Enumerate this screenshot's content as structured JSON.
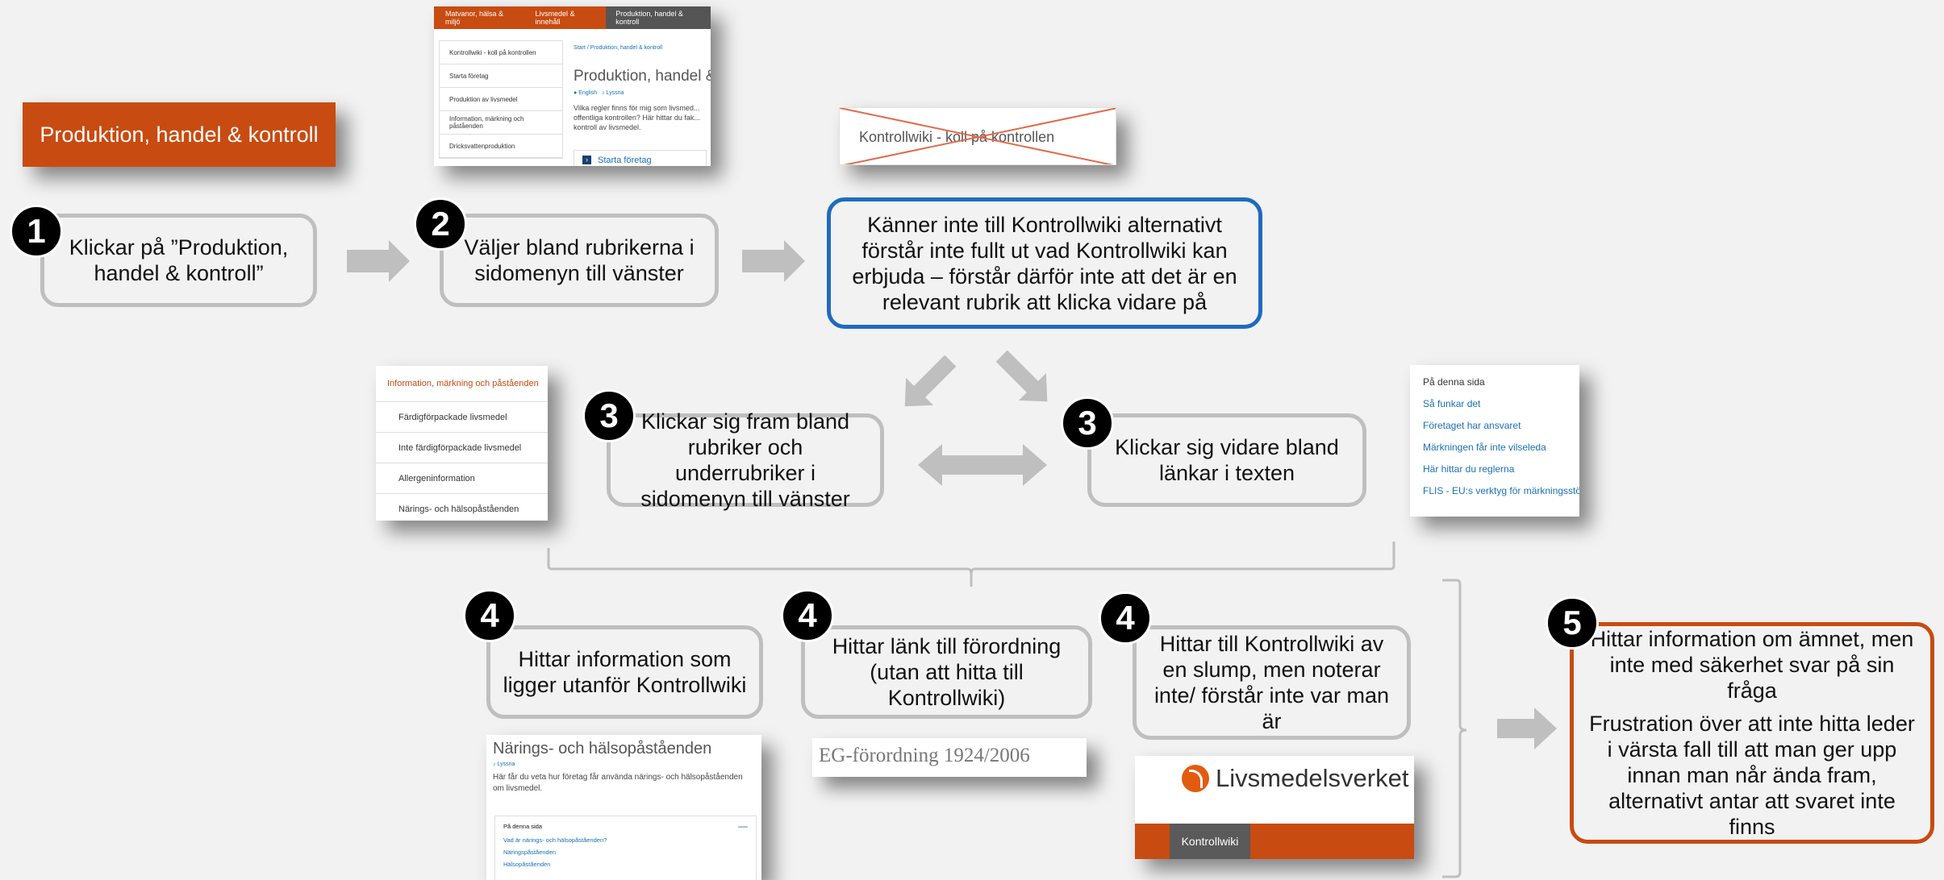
{
  "orange_button": {
    "label": "Produktion, handel & kontroll",
    "color": "#c84b11"
  },
  "top_screenshot": {
    "nav": [
      "Matvanor, hälsa & miljö",
      "Livsmedel & innehåll",
      "Produktion, handel & kontroll"
    ],
    "side_items": [
      "Kontrollwiki - koll på kontrollen",
      "Starta företag",
      "Produktion av livsmedel",
      "Information, märkning och påståenden",
      "Dricksvattenproduktion"
    ],
    "breadcrumb": "Start / Produktion, handel & kontroll",
    "heading": "Produktion, handel &",
    "lang_english": "English",
    "lang_lyssna": "Lyssna",
    "body": "Vilka regler finns för mig som livsmed... offentliga kontrollen? Här hittar du fak... kontroll av livsmedel.",
    "link": "Starta företag"
  },
  "crossed_tab": {
    "label": "Kontrollwiki - koll på kontrollen"
  },
  "steps": {
    "s1": {
      "num": "1",
      "text": "Klickar på ”Produktion, handel & kontroll”"
    },
    "s2": {
      "num": "2",
      "text": "Väljer bland rubrikerna i sidomenyn till vänster"
    },
    "blue": {
      "text": "Känner inte till Kontrollwiki alternativt förstår inte fullt ut vad Kontrollwiki kan erbjuda – förstår därför inte att det är en relevant rubrik att klicka vidare på"
    },
    "s3a": {
      "num": "3",
      "text": "Klickar sig fram bland rubriker och underrubriker i sidomenyn till vänster"
    },
    "s3b": {
      "num": "3",
      "text": "Klickar sig vidare bland länkar i texten"
    },
    "s4a": {
      "num": "4",
      "text": "Hittar information som ligger utanför Kontrollwiki"
    },
    "s4b": {
      "num": "4",
      "text": "Hittar länk till förordning (utan att hitta till Kontrollwiki)"
    },
    "s4c": {
      "num": "4",
      "text": "Hittar till Kontrollwiki av en slump, men noterar inte/ förstår inte var man är"
    },
    "s5": {
      "num": "5",
      "text1": "Hittar information om ämnet, men inte med säkerhet svar på sin fråga",
      "text2": "Frustration över att inte hitta leder i värsta fall till att man ger upp innan man når ända fram, alternativt antar att svaret inte finns"
    }
  },
  "left_submenu": {
    "title": "Information, märkning och påståenden",
    "items": [
      "Färdigförpackade livsmedel",
      "Inte färdigförpackade livsmedel",
      "Allergeninformation",
      "Närings- och hälsopåståenden"
    ]
  },
  "right_links": {
    "title": "På denna sida",
    "items": [
      "Så funkar det",
      "Företaget har ansvaret",
      "Märkningen får inte vilseleda",
      "Här hittar du reglerna",
      "FLIS - EU:s verktyg för märkningsstöd"
    ]
  },
  "narings_shot": {
    "heading": "Närings- och hälsopåståenden",
    "lyssna": "Lyssna",
    "body": "Här får du veta hur företag får använda närings- och hälsopåståenden om livsmedel.",
    "toc_title": "På denna sida",
    "toc_items": [
      "Vad är närings- och hälsopåståenden?",
      "Näringspåståenden",
      "Hälsopåståenden"
    ]
  },
  "eg_shot": {
    "text": "EG-förordning 1924/2006"
  },
  "lv_shot": {
    "brand": "Livsmedelsverket",
    "tab": "Kontrollwiki"
  },
  "colors": {
    "accent_orange": "#c84b11",
    "blue": "#1e6bbf",
    "gray_border": "#bfbfbf",
    "arrow": "#bfbfbf"
  }
}
